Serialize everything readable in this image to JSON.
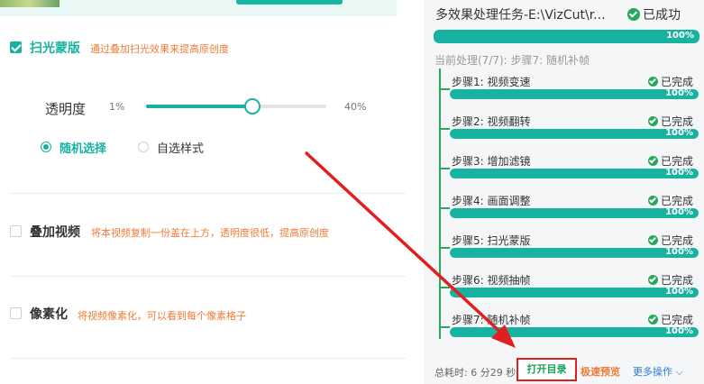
{
  "options": {
    "scan": {
      "title": "扫光蒙版",
      "desc": "通过叠加扫光效果来提高原创度",
      "checked": true
    },
    "opacity": {
      "label": "透明度",
      "min": "1%",
      "max": "40%",
      "value_fraction": 0.59
    },
    "style_radio": {
      "random": "随机选择",
      "custom": "自选样式",
      "selected": "random"
    },
    "overlay": {
      "title": "叠加视频",
      "desc": "将本视频复制一份盖在上方，透明度很低，提高原创度",
      "checked": false
    },
    "pixel": {
      "title": "像素化",
      "desc": "将视频像素化，可以看到每个像素格子",
      "checked": false
    }
  },
  "task": {
    "title": "多效果处理任务-E:\\VizCut\\r...",
    "status": "已成功",
    "progress_label": "100%",
    "progress": 1.0,
    "current": "当前处理(7/7): 步骤7: 随机补帧",
    "steps": [
      {
        "label": "步骤1: 视频变速",
        "status": "已完成",
        "progress_label": "100%"
      },
      {
        "label": "步骤2: 视频翻转",
        "status": "已完成",
        "progress_label": "100%"
      },
      {
        "label": "步骤3: 增加滤镜",
        "status": "已完成",
        "progress_label": "100%"
      },
      {
        "label": "步骤4: 画面调整",
        "status": "已完成",
        "progress_label": "100%"
      },
      {
        "label": "步骤5: 扫光蒙版",
        "status": "已完成",
        "progress_label": "100%"
      },
      {
        "label": "步骤6: 视频抽帧",
        "status": "已完成",
        "progress_label": "100%"
      },
      {
        "label": "步骤7: 随机补帧",
        "status": "已完成",
        "progress_label": "100%"
      }
    ],
    "footer": {
      "elapsed": "总耗时: 6 分29 秒",
      "open_dir": "打开目录",
      "fast_preview": "极速预览",
      "more": "更多操作"
    }
  },
  "colors": {
    "accent": "#17b3a0",
    "success": "#29a85a",
    "warning": "#f07b36",
    "link": "#2a7cd8",
    "highlight": "#e02020"
  },
  "icons": [
    "check-icon",
    "checkbox-icon",
    "radio-icon",
    "chevron-down-icon"
  ]
}
